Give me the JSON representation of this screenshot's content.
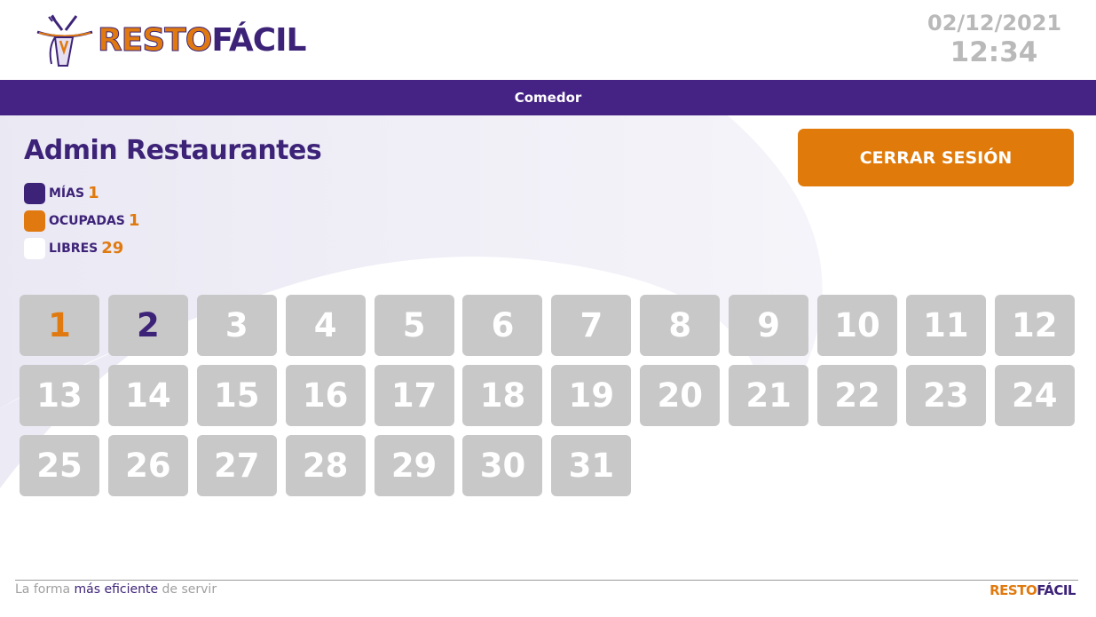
{
  "brand": {
    "logo_part1": "RESTO",
    "logo_part2": "FÁCIL"
  },
  "header": {
    "date": "02/12/2021",
    "time": "12:34"
  },
  "nav": {
    "tab_label": "Comedor"
  },
  "user": {
    "name": "Admin Restaurantes"
  },
  "legend": {
    "mine": {
      "label": "MÍAS",
      "count": "1",
      "color": "#3d2378"
    },
    "occupied": {
      "label": "OCUPADAS",
      "count": "1",
      "color": "#e07a10"
    },
    "free": {
      "label": "LIBRES",
      "count": "29",
      "color": "#ffffff"
    }
  },
  "actions": {
    "logout_label": "CERRAR SESIÓN"
  },
  "tables": [
    {
      "number": "1",
      "status": "occupied"
    },
    {
      "number": "2",
      "status": "mine"
    },
    {
      "number": "3",
      "status": "free"
    },
    {
      "number": "4",
      "status": "free"
    },
    {
      "number": "5",
      "status": "free"
    },
    {
      "number": "6",
      "status": "free"
    },
    {
      "number": "7",
      "status": "free"
    },
    {
      "number": "8",
      "status": "free"
    },
    {
      "number": "9",
      "status": "free"
    },
    {
      "number": "10",
      "status": "free"
    },
    {
      "number": "11",
      "status": "free"
    },
    {
      "number": "12",
      "status": "free"
    },
    {
      "number": "13",
      "status": "free"
    },
    {
      "number": "14",
      "status": "free"
    },
    {
      "number": "15",
      "status": "free"
    },
    {
      "number": "16",
      "status": "free"
    },
    {
      "number": "17",
      "status": "free"
    },
    {
      "number": "18",
      "status": "free"
    },
    {
      "number": "19",
      "status": "free"
    },
    {
      "number": "20",
      "status": "free"
    },
    {
      "number": "21",
      "status": "free"
    },
    {
      "number": "22",
      "status": "free"
    },
    {
      "number": "23",
      "status": "free"
    },
    {
      "number": "24",
      "status": "free"
    },
    {
      "number": "25",
      "status": "free"
    },
    {
      "number": "26",
      "status": "free"
    },
    {
      "number": "27",
      "status": "free"
    },
    {
      "number": "28",
      "status": "free"
    },
    {
      "number": "29",
      "status": "free"
    },
    {
      "number": "30",
      "status": "free"
    },
    {
      "number": "31",
      "status": "free"
    }
  ],
  "footer": {
    "tagline_part1": "La forma ",
    "tagline_part2": "más eficiente",
    "tagline_part3": " de servir",
    "logo_part1": "RESTO",
    "logo_part2": "FÁCIL"
  },
  "colors": {
    "accent": "#e07a10",
    "brand": "#452384",
    "table_bg": "#c8c8c8",
    "muted": "#b9b9b9"
  }
}
